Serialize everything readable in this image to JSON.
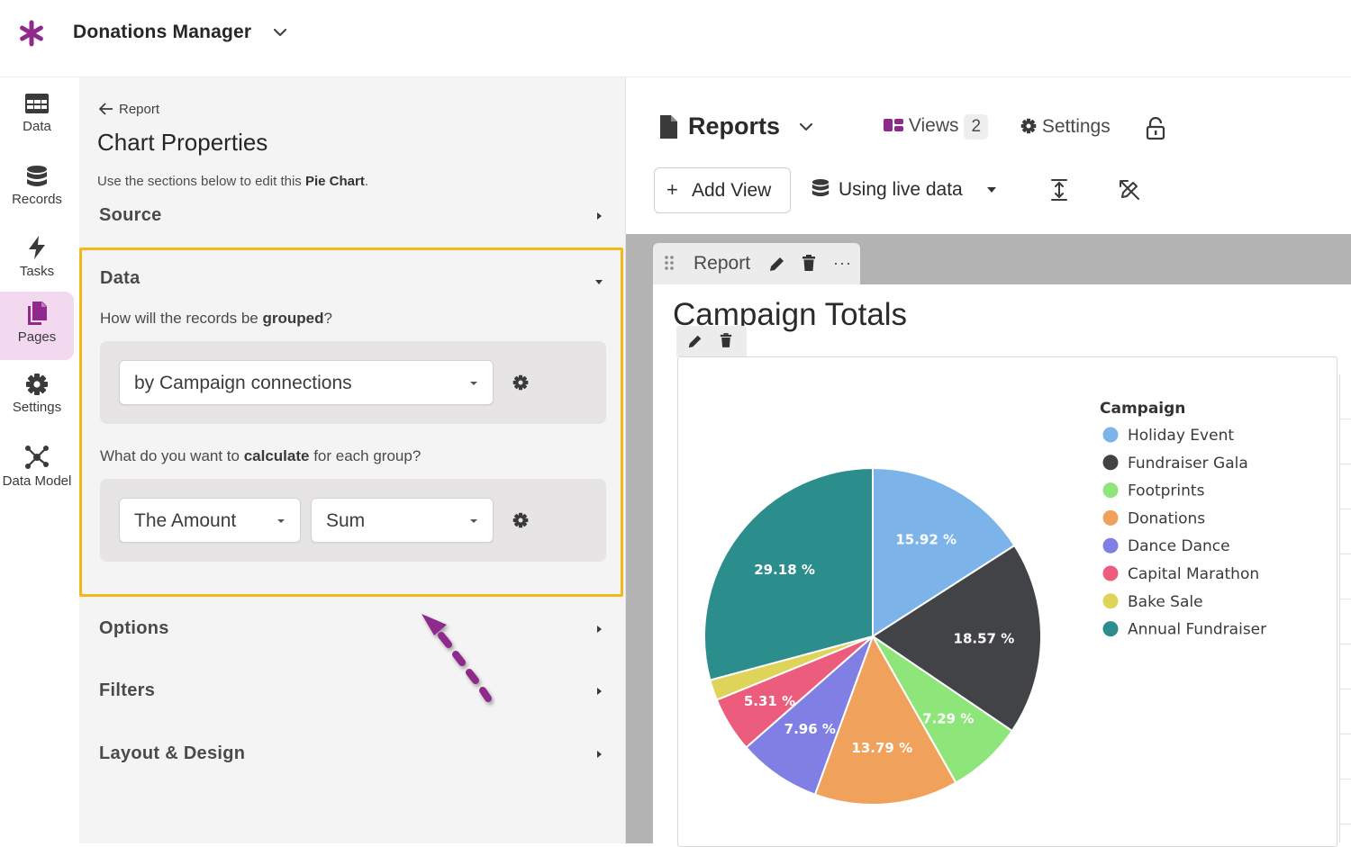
{
  "app": {
    "title": "Donations Manager",
    "brand_color": "#8e2a8b"
  },
  "nav": [
    {
      "label": "Data",
      "icon": "table-icon"
    },
    {
      "label": "Records",
      "icon": "database-icon"
    },
    {
      "label": "Tasks",
      "icon": "lightning-icon"
    },
    {
      "label": "Pages",
      "icon": "pages-icon",
      "active": true
    },
    {
      "label": "Settings",
      "icon": "gear-icon"
    },
    {
      "label": "Data Model",
      "icon": "data-model-icon"
    }
  ],
  "panel": {
    "back_label": "Report",
    "title": "Chart Properties",
    "desc_prefix": "Use the sections below to edit this ",
    "desc_bold": "Pie Chart",
    "desc_suffix": ".",
    "sections": {
      "source": "Source",
      "data": "Data",
      "options": "Options",
      "filters": "Filters",
      "layout": "Layout & Design"
    },
    "group_q_prefix": "How will the records be ",
    "group_q_bold": "grouped",
    "group_q_suffix": "?",
    "group_value": "by Campaign connections",
    "calc_q_prefix": "What do you want to ",
    "calc_q_bold": "calculate",
    "calc_q_suffix": " for each group?",
    "calc_field": "The Amount",
    "calc_func": "Sum",
    "highlight_color": "#f2b818"
  },
  "header": {
    "reports_label": "Reports",
    "views_label": "Views",
    "views_count": "2",
    "settings_label": "Settings",
    "add_view_label": "Add View",
    "live_data_label": "Using live data"
  },
  "report": {
    "tab_label": "Report",
    "more_label": "···"
  },
  "chart_data": {
    "type": "pie",
    "title": "Campaign Totals",
    "legend_title": "Campaign",
    "legend_position": "right",
    "slices": [
      {
        "name": "Holiday Event",
        "value": 15.92,
        "label": "15.92 %",
        "color": "#7cb3e8"
      },
      {
        "name": "Fundraiser Gala",
        "value": 18.57,
        "label": "18.57 %",
        "color": "#424347"
      },
      {
        "name": "Footprints",
        "value": 7.29,
        "label": "7.29 %",
        "color": "#8ee67a"
      },
      {
        "name": "Donations",
        "value": 13.79,
        "label": "13.79 %",
        "color": "#f0a25c"
      },
      {
        "name": "Dance Dance",
        "value": 7.96,
        "label": "7.96 %",
        "color": "#8080e4"
      },
      {
        "name": "Capital Marathon",
        "value": 5.31,
        "label": "5.31 %",
        "color": "#ec5c7c"
      },
      {
        "name": "Bake Sale",
        "value": 1.98,
        "label": "",
        "color": "#dfd45a"
      },
      {
        "name": "Annual Fundraiser",
        "value": 29.18,
        "label": "29.18 %",
        "color": "#2b8e8c"
      }
    ]
  }
}
